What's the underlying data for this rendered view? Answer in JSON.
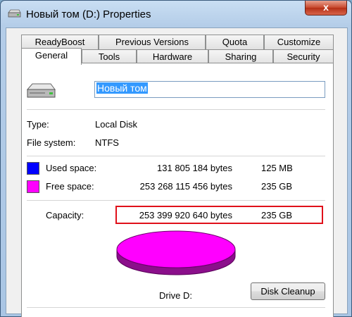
{
  "window": {
    "title": "Новый том (D:) Properties",
    "close_glyph": "x"
  },
  "tabs": {
    "row1": [
      "ReadyBoost",
      "Previous Versions",
      "Quota",
      "Customize"
    ],
    "row2": [
      "General",
      "Tools",
      "Hardware",
      "Sharing",
      "Security"
    ],
    "active": "General"
  },
  "general": {
    "volume_name": "Новый том",
    "type_label": "Type:",
    "type_value": "Local Disk",
    "fs_label": "File system:",
    "fs_value": "NTFS",
    "used": {
      "label": "Used space:",
      "bytes": "131 805 184 bytes",
      "size": "125 MB",
      "color": "#0000ff"
    },
    "free": {
      "label": "Free space:",
      "bytes": "253 268 115 456 bytes",
      "size": "235 GB",
      "color": "#ff00ff"
    },
    "capacity": {
      "label": "Capacity:",
      "bytes": "253 399 920 640 bytes",
      "size": "235 GB"
    },
    "drive_label": "Drive D:",
    "disk_cleanup_label": "Disk Cleanup",
    "icons": {
      "drive": "hard-drive-icon"
    }
  }
}
